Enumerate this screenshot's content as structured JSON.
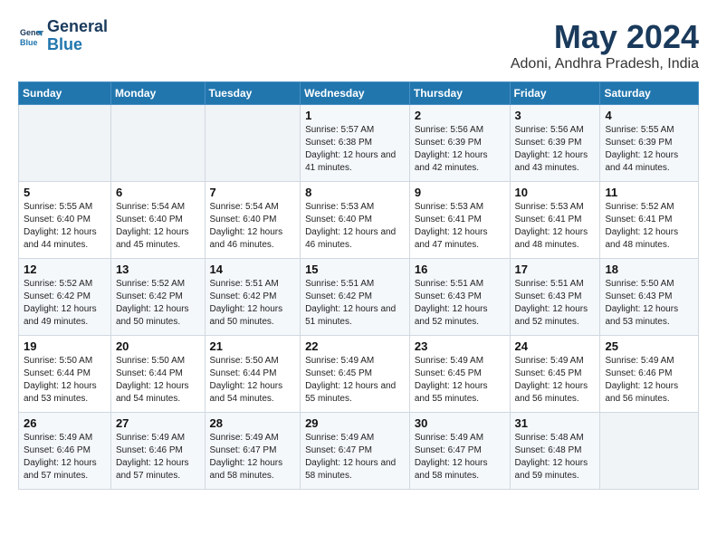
{
  "header": {
    "logo_line1": "General",
    "logo_line2": "Blue",
    "title": "May 2024",
    "subtitle": "Adoni, Andhra Pradesh, India"
  },
  "columns": [
    "Sunday",
    "Monday",
    "Tuesday",
    "Wednesday",
    "Thursday",
    "Friday",
    "Saturday"
  ],
  "weeks": [
    [
      {
        "day": "",
        "info": ""
      },
      {
        "day": "",
        "info": ""
      },
      {
        "day": "",
        "info": ""
      },
      {
        "day": "1",
        "info": "Sunrise: 5:57 AM\nSunset: 6:38 PM\nDaylight: 12 hours\nand 41 minutes."
      },
      {
        "day": "2",
        "info": "Sunrise: 5:56 AM\nSunset: 6:39 PM\nDaylight: 12 hours\nand 42 minutes."
      },
      {
        "day": "3",
        "info": "Sunrise: 5:56 AM\nSunset: 6:39 PM\nDaylight: 12 hours\nand 43 minutes."
      },
      {
        "day": "4",
        "info": "Sunrise: 5:55 AM\nSunset: 6:39 PM\nDaylight: 12 hours\nand 44 minutes."
      }
    ],
    [
      {
        "day": "5",
        "info": "Sunrise: 5:55 AM\nSunset: 6:40 PM\nDaylight: 12 hours\nand 44 minutes."
      },
      {
        "day": "6",
        "info": "Sunrise: 5:54 AM\nSunset: 6:40 PM\nDaylight: 12 hours\nand 45 minutes."
      },
      {
        "day": "7",
        "info": "Sunrise: 5:54 AM\nSunset: 6:40 PM\nDaylight: 12 hours\nand 46 minutes."
      },
      {
        "day": "8",
        "info": "Sunrise: 5:53 AM\nSunset: 6:40 PM\nDaylight: 12 hours\nand 46 minutes."
      },
      {
        "day": "9",
        "info": "Sunrise: 5:53 AM\nSunset: 6:41 PM\nDaylight: 12 hours\nand 47 minutes."
      },
      {
        "day": "10",
        "info": "Sunrise: 5:53 AM\nSunset: 6:41 PM\nDaylight: 12 hours\nand 48 minutes."
      },
      {
        "day": "11",
        "info": "Sunrise: 5:52 AM\nSunset: 6:41 PM\nDaylight: 12 hours\nand 48 minutes."
      }
    ],
    [
      {
        "day": "12",
        "info": "Sunrise: 5:52 AM\nSunset: 6:42 PM\nDaylight: 12 hours\nand 49 minutes."
      },
      {
        "day": "13",
        "info": "Sunrise: 5:52 AM\nSunset: 6:42 PM\nDaylight: 12 hours\nand 50 minutes."
      },
      {
        "day": "14",
        "info": "Sunrise: 5:51 AM\nSunset: 6:42 PM\nDaylight: 12 hours\nand 50 minutes."
      },
      {
        "day": "15",
        "info": "Sunrise: 5:51 AM\nSunset: 6:42 PM\nDaylight: 12 hours\nand 51 minutes."
      },
      {
        "day": "16",
        "info": "Sunrise: 5:51 AM\nSunset: 6:43 PM\nDaylight: 12 hours\nand 52 minutes."
      },
      {
        "day": "17",
        "info": "Sunrise: 5:51 AM\nSunset: 6:43 PM\nDaylight: 12 hours\nand 52 minutes."
      },
      {
        "day": "18",
        "info": "Sunrise: 5:50 AM\nSunset: 6:43 PM\nDaylight: 12 hours\nand 53 minutes."
      }
    ],
    [
      {
        "day": "19",
        "info": "Sunrise: 5:50 AM\nSunset: 6:44 PM\nDaylight: 12 hours\nand 53 minutes."
      },
      {
        "day": "20",
        "info": "Sunrise: 5:50 AM\nSunset: 6:44 PM\nDaylight: 12 hours\nand 54 minutes."
      },
      {
        "day": "21",
        "info": "Sunrise: 5:50 AM\nSunset: 6:44 PM\nDaylight: 12 hours\nand 54 minutes."
      },
      {
        "day": "22",
        "info": "Sunrise: 5:49 AM\nSunset: 6:45 PM\nDaylight: 12 hours\nand 55 minutes."
      },
      {
        "day": "23",
        "info": "Sunrise: 5:49 AM\nSunset: 6:45 PM\nDaylight: 12 hours\nand 55 minutes."
      },
      {
        "day": "24",
        "info": "Sunrise: 5:49 AM\nSunset: 6:45 PM\nDaylight: 12 hours\nand 56 minutes."
      },
      {
        "day": "25",
        "info": "Sunrise: 5:49 AM\nSunset: 6:46 PM\nDaylight: 12 hours\nand 56 minutes."
      }
    ],
    [
      {
        "day": "26",
        "info": "Sunrise: 5:49 AM\nSunset: 6:46 PM\nDaylight: 12 hours\nand 57 minutes."
      },
      {
        "day": "27",
        "info": "Sunrise: 5:49 AM\nSunset: 6:46 PM\nDaylight: 12 hours\nand 57 minutes."
      },
      {
        "day": "28",
        "info": "Sunrise: 5:49 AM\nSunset: 6:47 PM\nDaylight: 12 hours\nand 58 minutes."
      },
      {
        "day": "29",
        "info": "Sunrise: 5:49 AM\nSunset: 6:47 PM\nDaylight: 12 hours\nand 58 minutes."
      },
      {
        "day": "30",
        "info": "Sunrise: 5:49 AM\nSunset: 6:47 PM\nDaylight: 12 hours\nand 58 minutes."
      },
      {
        "day": "31",
        "info": "Sunrise: 5:48 AM\nSunset: 6:48 PM\nDaylight: 12 hours\nand 59 minutes."
      },
      {
        "day": "",
        "info": ""
      }
    ]
  ]
}
